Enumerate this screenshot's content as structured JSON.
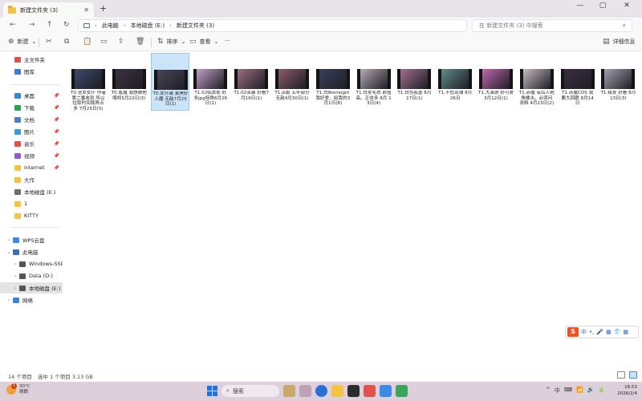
{
  "window": {
    "tab_title": "新建文件夹 (3)",
    "new_tab": "+",
    "controls": [
      "—",
      "▢",
      "✕"
    ]
  },
  "breadcrumb": [
    "此电脑",
    "本地磁盘 (E:)",
    "新建文件夹 (3)"
  ],
  "search": {
    "placeholder": "在 新建文件夹 (3) 中搜索"
  },
  "toolbar": {
    "new_label": "新建",
    "sort_label": "排序",
    "view_label": "查看",
    "more_label": "···",
    "details_label": "详细信息"
  },
  "sidebar": {
    "quick": [
      {
        "label": "主文件夹",
        "icon": "home-icon",
        "color": "#d9534f"
      },
      {
        "label": "图库",
        "icon": "gallery-icon",
        "color": "#3a7bd5"
      }
    ],
    "pinned": [
      {
        "label": "桌面",
        "icon": "desktop-icon",
        "color": "#3a86d4"
      },
      {
        "label": "下载",
        "icon": "download-icon",
        "color": "#2f9e5b"
      },
      {
        "label": "文档",
        "icon": "documents-icon",
        "color": "#4a7fc1"
      },
      {
        "label": "图片",
        "icon": "pictures-icon",
        "color": "#3c9bd6"
      },
      {
        "label": "音乐",
        "icon": "music-icon",
        "color": "#e0524a"
      },
      {
        "label": "视频",
        "icon": "videos-icon",
        "color": "#8e5bd0"
      },
      {
        "label": "internet",
        "icon": "folder-icon",
        "color": "#f4c440"
      },
      {
        "label": "大作",
        "icon": "folder-icon",
        "color": "#f4c440"
      },
      {
        "label": "本地磁盘 (E:)",
        "icon": "drive-icon",
        "color": "#6d6d6d"
      },
      {
        "label": "1",
        "icon": "folder-icon",
        "color": "#f4c440"
      },
      {
        "label": "KITTY",
        "icon": "folder-icon",
        "color": "#f4c440"
      }
    ],
    "tree": [
      {
        "label": "WPS云盘",
        "icon": "wps-cloud-icon",
        "color": "#3b8be6",
        "chev": "›"
      },
      {
        "label": "此电脑",
        "icon": "pc-icon",
        "color": "#3a6fb5",
        "chev": "⌄"
      },
      {
        "label": "Windows-SSD (C",
        "icon": "drive-icon",
        "color": "#555555",
        "chev": "›"
      },
      {
        "label": "Data (D:)",
        "icon": "drive-icon",
        "color": "#555555",
        "chev": "›"
      },
      {
        "label": "本地磁盘 (E:)",
        "icon": "drive-icon",
        "color": "#555555",
        "chev": "›"
      },
      {
        "label": "网络",
        "icon": "network-icon",
        "color": "#3a86d4",
        "chev": "›"
      }
    ]
  },
  "files": [
    {
      "name": "T0.坚发女仆 作者 第二番收到 所以 拉取时间我再点 多 7月25日(5)",
      "bg": "#3c4a6a"
    },
    {
      "name": "T0.氪魔 我想做他 哪邦5月22日(3)",
      "bg": "#3b3340"
    },
    {
      "name": "T0.女仆装 黄黑好 人魔 无敌7月25 日(1)",
      "bg": "#4a4458"
    },
    {
      "name": "T1.02临女那 好 多jpg特殊6月26 日(1)",
      "bg": "#c0a0c6"
    },
    {
      "name": "T1.02泳装 好看7 月16日(1)",
      "bg": "#9c6e80"
    },
    {
      "name": "T1.jk服 五竿部分 无敌4月30日(1)",
      "bg": "#8a5b6a"
    },
    {
      "name": "T1.白丝emogirl 我好爱，给我的3 月1日(8)",
      "bg": "#3a3f5c"
    },
    {
      "name": "T1.白发毛衣 颜值 高。正炫多 8月 13日(4)",
      "bg": "#b6a9b4"
    },
    {
      "name": "T1.白色孤墨 8月 17日(1)",
      "bg": "#a26f8f"
    },
    {
      "name": "T1.不危出薄 8月 26日",
      "bg": "#5f8a88"
    },
    {
      "name": "T1.大演游 好可爱 3月12日(1)",
      "bg": "#c066b0"
    },
    {
      "name": "T1.赤魔 有后人绝 角楼水。必须问 测档 4月23日(2)",
      "bg": "#c6bac2"
    },
    {
      "name": "T1.赤魔COS 我 要大回跟 8月14 日",
      "bg": "#3b2d42"
    },
    {
      "name": "T1.叛友 好看 8月 13日(3)",
      "bg": "#a3a0ae"
    }
  ],
  "status": {
    "count": "14 个项目",
    "selected": "选中 1 个项目  3.13 GB"
  },
  "ime": {
    "logo": "S",
    "mode": "中",
    "icons": [
      "•,",
      "🎤",
      "▦",
      "👕",
      "▦"
    ]
  },
  "taskbar": {
    "weather_temp": "30°C",
    "weather_desc": "晴朗",
    "weather_badge": "1",
    "search_label": "搜索",
    "time": "16:53",
    "date": "2026/2/4",
    "tray": [
      "^",
      "中",
      "⌨",
      "📶",
      "🔊",
      "🔋"
    ]
  }
}
